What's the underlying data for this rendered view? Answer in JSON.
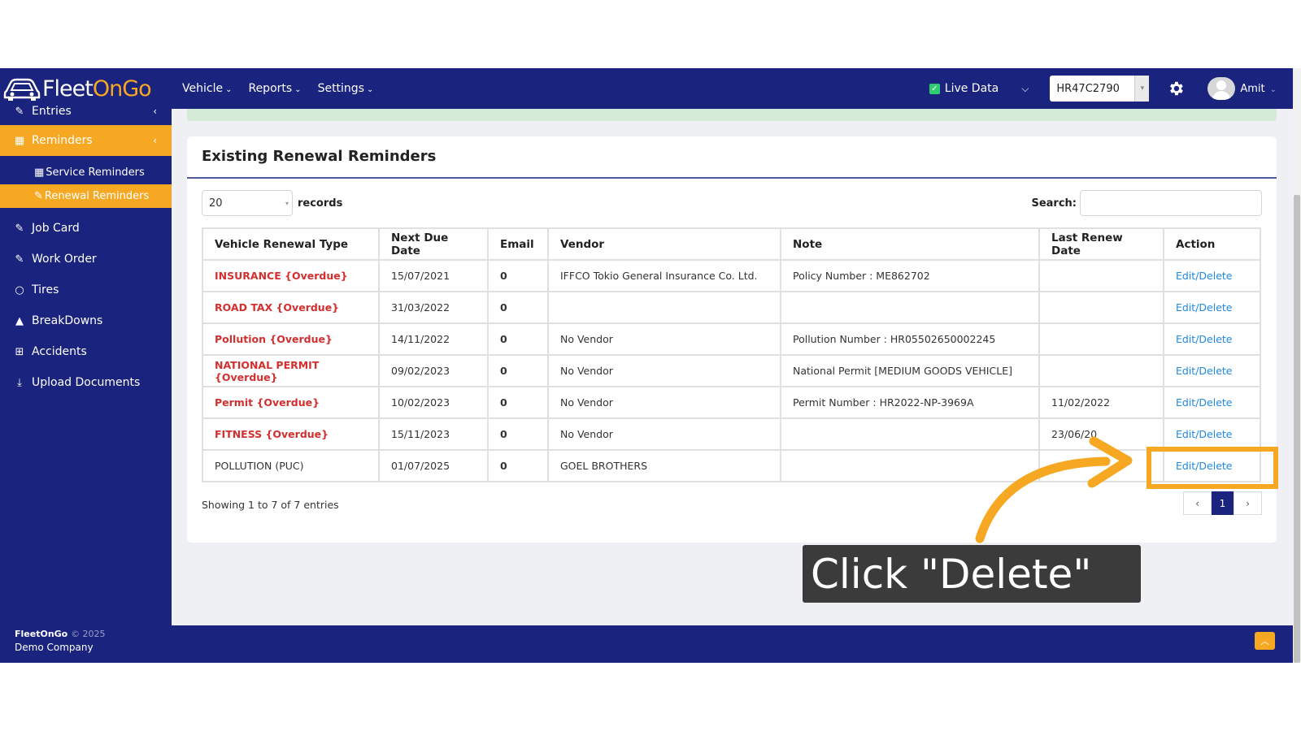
{
  "brand": {
    "logo_part1": "Fleet",
    "logo_part2": "OnGo"
  },
  "nav": {
    "menus": [
      {
        "label": "Vehicle"
      },
      {
        "label": "Reports"
      },
      {
        "label": "Settings"
      }
    ],
    "live_data_label": "Live Data",
    "vehicle_select": "HR47C2790",
    "user_name": "Amit"
  },
  "sidebar": {
    "entries_label": "Entries",
    "reminders_label": "Reminders",
    "submenu": [
      {
        "label": "Service Reminders"
      },
      {
        "label": "Renewal Reminders"
      }
    ],
    "items": [
      {
        "label": "Job Card"
      },
      {
        "label": "Work Order"
      },
      {
        "label": "Tires"
      },
      {
        "label": "BreakDowns"
      },
      {
        "label": "Accidents"
      },
      {
        "label": "Upload Documents"
      }
    ],
    "footer": {
      "brand": "FleetOnGo",
      "year": "© 2025",
      "company": "Demo Company"
    }
  },
  "card": {
    "title": "Existing Renewal Reminders",
    "page_length": "20",
    "records_label": "records",
    "search_label": "Search:",
    "search_value": "",
    "columns": [
      "Vehicle Renewal Type",
      "Next Due Date",
      "Email",
      "Vendor",
      "Note",
      "Last Renew Date",
      "Action"
    ],
    "rows": [
      {
        "type": "INSURANCE {Overdue}",
        "overdue": true,
        "due": "15/07/2021",
        "email": "0",
        "vendor": "IFFCO Tokio General Insurance Co. Ltd.",
        "note": "Policy Number : ME862702",
        "last": "",
        "action": "Edit/Delete"
      },
      {
        "type": "ROAD TAX {Overdue}",
        "overdue": true,
        "due": "31/03/2022",
        "email": "0",
        "vendor": "",
        "note": "",
        "last": "",
        "action": "Edit/Delete"
      },
      {
        "type": "Pollution {Overdue}",
        "overdue": true,
        "due": "14/11/2022",
        "email": "0",
        "vendor": "No Vendor",
        "note": "Pollution Number : HR05502650002245",
        "last": "",
        "action": "Edit/Delete"
      },
      {
        "type": "NATIONAL PERMIT {Overdue}",
        "overdue": true,
        "due": "09/02/2023",
        "email": "0",
        "vendor": "No Vendor",
        "note": "National Permit [MEDIUM GOODS VEHICLE]",
        "last": "",
        "action": "Edit/Delete"
      },
      {
        "type": "Permit {Overdue}",
        "overdue": true,
        "due": "10/02/2023",
        "email": "0",
        "vendor": "No Vendor",
        "note": "Permit Number : HR2022-NP-3969A",
        "last": "11/02/2022",
        "action": "Edit/Delete"
      },
      {
        "type": "FITNESS {Overdue}",
        "overdue": true,
        "due": "15/11/2023",
        "email": "0",
        "vendor": "No Vendor",
        "note": "",
        "last": "23/06/20",
        "action": "Edit/Delete"
      },
      {
        "type": "POLLUTION (PUC)",
        "overdue": false,
        "due": "01/07/2025",
        "email": "0",
        "vendor": "GOEL BROTHERS",
        "note": "",
        "last": "",
        "action": "Edit/Delete"
      }
    ],
    "info_text": "Showing 1 to 7 of 7 entries",
    "pager": {
      "prev": "‹",
      "current": "1",
      "next": "›"
    }
  },
  "annotation": {
    "callout_text": "Click \"Delete\""
  },
  "colors": {
    "navy": "#1a237e",
    "accent": "#f7a823",
    "overdue": "#d32f2f",
    "link": "#1e88e5"
  }
}
